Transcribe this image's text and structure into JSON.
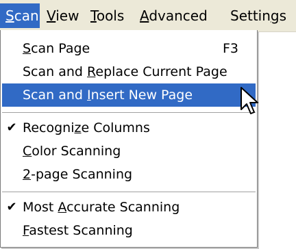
{
  "menubar": {
    "items": [
      {
        "label": "Scan",
        "mnemonic_index": 0,
        "active": true
      },
      {
        "label": "View",
        "mnemonic_index": 0,
        "active": false
      },
      {
        "label": "Tools",
        "mnemonic_index": 0,
        "active": false
      },
      {
        "label": "Advanced",
        "mnemonic_index": 0,
        "active": false
      },
      {
        "label": "Settings",
        "mnemonic_index": 7,
        "active": false
      }
    ]
  },
  "scan_menu": {
    "scan_page": {
      "pre": "",
      "ul": "S",
      "post": "can Page",
      "shortcut": "F3"
    },
    "scan_replace": {
      "pre": "Scan and ",
      "ul": "R",
      "post": "eplace Current Page"
    },
    "scan_insert": {
      "pre": "Scan and ",
      "ul": "I",
      "post": "nsert New Page"
    },
    "recognize_columns": {
      "pre": "Recogni",
      "ul": "z",
      "post": "e Columns",
      "checked": true,
      "check_glyph": "✔"
    },
    "color_scanning": {
      "pre": "",
      "ul": "C",
      "post": "olor Scanning"
    },
    "two_page_scanning": {
      "pre": "",
      "ul": "2",
      "post": "-page Scanning"
    },
    "most_accurate": {
      "pre": "Most ",
      "ul": "A",
      "post": "ccurate Scanning",
      "checked": true,
      "check_glyph": "✔"
    },
    "fastest": {
      "pre": "",
      "ul": "F",
      "post": "astest Scanning"
    }
  },
  "colors": {
    "menubar_bg": "#ece9d8",
    "highlight": "#316ac5",
    "highlight_text": "#ffffff"
  },
  "cursor_icon": "arrow-pointer-icon"
}
